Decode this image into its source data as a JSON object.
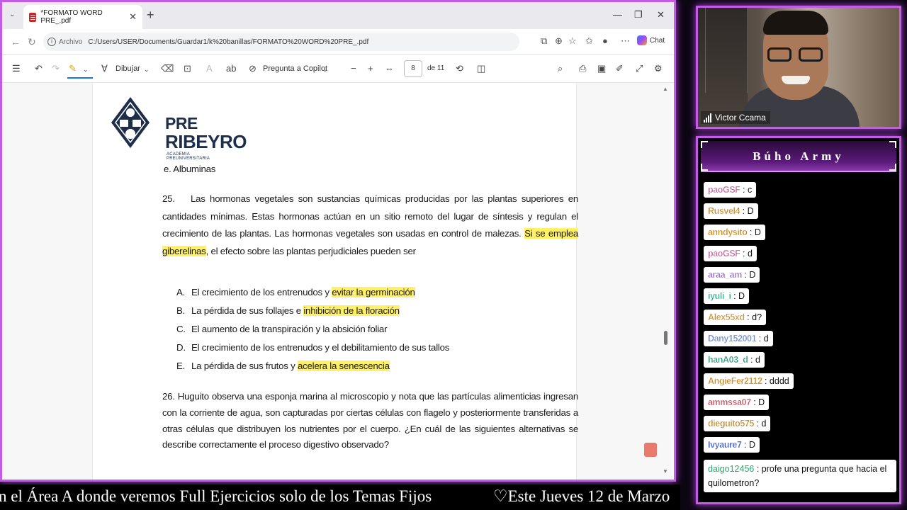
{
  "browser": {
    "tab_title": "*FORMATO WORD PRE_.pdf",
    "address_prefix": "Archivo",
    "url": "C:/Users/USER/Documents/Guardar1/k%20banillas/FORMATO%20WORD%20PRE_.pdf",
    "chat_label": "Chat"
  },
  "pdf_toolbar": {
    "draw_label": "Dibujar",
    "copilot_label": "Pregunta a Copilot",
    "current_page": "8",
    "total_pages": "de 11"
  },
  "document": {
    "logo_line1": "PRE",
    "logo_line2": "RIBEYRO",
    "logo_subtitle": "ACADEMIA PREUNIVERSITARIA",
    "prev_option": "e.   Albuminas",
    "q25_number": "25.",
    "q25_text_a": "Las hormonas vegetales son sustancias químicas producidas por las plantas superiores en cantidades mínimas. Estas hormonas actúan en un sitio remoto del lugar de síntesis y regulan el crecimiento de las plantas. Las hormonas vegetales son usadas en control de malezas. ",
    "q25_highlight": "Si se emplea giberelinas",
    "q25_text_b": ", el efecto sobre las plantas perjudiciales pueden ser",
    "q25_options": [
      {
        "letter": "A.",
        "text": "El crecimiento de los entrenudos y ",
        "highlight": "evitar la germinación"
      },
      {
        "letter": "B.",
        "text": "La pérdida de sus follajes e ",
        "highlight": "inhibición de la floración"
      },
      {
        "letter": "C.",
        "text": "El aumento de la transpiración y la absición foliar",
        "highlight": ""
      },
      {
        "letter": "D.",
        "text": "El crecimiento de los entrenudos y el debilitamiento de sus tallos",
        "highlight": ""
      },
      {
        "letter": "E.",
        "text": "La pérdida de sus frutos y ",
        "highlight": "acelera la senescencia"
      }
    ],
    "q26_text": "26. Huguito observa una esponja marina al microscopio y nota que las partículas alimenticias ingresan con la corriente de agua, son capturadas por ciertas células con flagelo y posteriormente transferidas a otras células que distribuyen los nutrientes por el cuerpo.  ¿En cuál de las siguientes alternativas se describe correctamente el proceso digestivo observado?"
  },
  "webcam": {
    "name": "Victor Ccama"
  },
  "chat": {
    "title": "Búho Army",
    "messages": [
      {
        "user": "paoGSF",
        "text": " : c",
        "color": "#c06a9a"
      },
      {
        "user": "Rusvel4",
        "text": " : D",
        "color": "#c98a2a"
      },
      {
        "user": "anndysito",
        "text": " : D",
        "color": "#d08a10"
      },
      {
        "user": "paoGSF",
        "text": " : d",
        "color": "#c06a9a"
      },
      {
        "user": "araa_am",
        "text": " : D",
        "color": "#9a6ad0"
      },
      {
        "user": "iyuli_i",
        "text": " : D",
        "color": "#2aaa88"
      },
      {
        "user": "Alex55xd",
        "text": " : d?",
        "color": "#d09030"
      },
      {
        "user": "Dany152001",
        "text": " : d",
        "color": "#6a8ad0"
      },
      {
        "user": "hanA03_d",
        "text": " : d",
        "color": "#2a9a7a"
      },
      {
        "user": "AngieFer2112",
        "text": " : dddd",
        "color": "#d08a20"
      },
      {
        "user": "ammssa07",
        "text": " : D",
        "color": "#c04a5a"
      },
      {
        "user": "dieguito575",
        "text": " : d",
        "color": "#c08a30"
      },
      {
        "user": "Ivyaure7",
        "text": " : D",
        "color": "#3a5ad0"
      }
    ],
    "last_user": "daigo12456",
    "last_user_color": "#2aaa6a",
    "last_text": " : profe una pregunta que hacia el quilometron?"
  },
  "ticker": {
    "left_text": "n el Área A donde veremos Full Ejercicios solo de los Temas Fijos",
    "right_text": "♡Este Jueves 12 de Marzo"
  }
}
